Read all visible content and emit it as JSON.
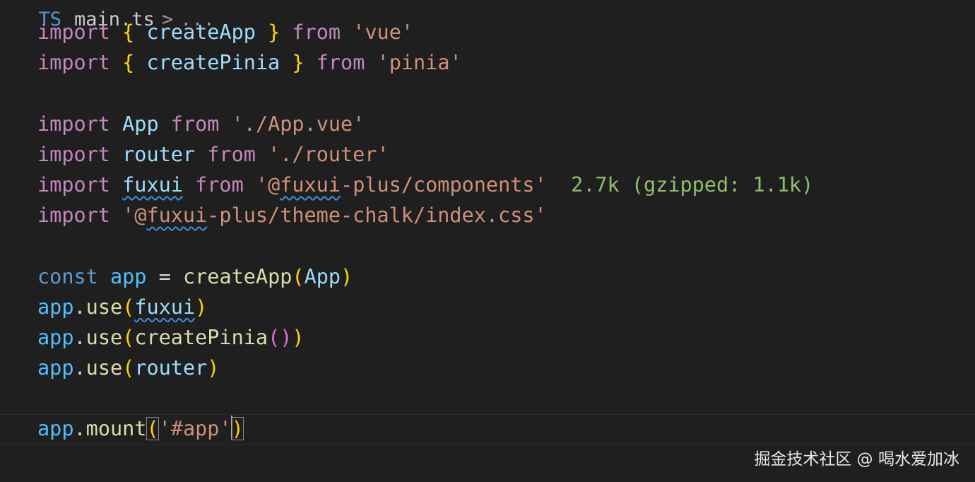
{
  "breadcrumb": {
    "lang_badge": "TS",
    "file": "main.ts",
    "separator": ">",
    "more": "..."
  },
  "code": {
    "l1": {
      "kw1": "import",
      "b1": "{",
      "name": "createApp",
      "b2": "}",
      "kw2": "from",
      "src": "'vue'"
    },
    "l2": {
      "kw1": "import",
      "b1": "{",
      "name": "createPinia",
      "b2": "}",
      "kw2": "from",
      "src": "'pinia'"
    },
    "l4": {
      "kw1": "import",
      "name": "App",
      "kw2": "from",
      "src": "'./App.vue'"
    },
    "l5": {
      "kw1": "import",
      "name": "router",
      "kw2": "from",
      "src": "'./router'"
    },
    "l6": {
      "kw1": "import",
      "name": "fuxui",
      "kw2": "from",
      "src_pre": "'@",
      "src_squig": "fuxui",
      "src_post": "-plus/components'",
      "hint": "2.7k (gzipped: 1.1k)"
    },
    "l7": {
      "kw1": "import",
      "src_pre": "'@",
      "src_squig": "fuxui",
      "src_post": "-plus/theme-chalk/index.css'"
    },
    "l9": {
      "kw": "const",
      "name": "app",
      "op": "=",
      "fn": "createApp",
      "open": "(",
      "arg": "App",
      "close": ")"
    },
    "l10": {
      "obj": "app",
      "dot": ".",
      "fn": "use",
      "open": "(",
      "arg": "fuxui",
      "close": ")"
    },
    "l11": {
      "obj": "app",
      "dot": ".",
      "fn": "use",
      "open": "(",
      "fn2": "createPinia",
      "open2": "(",
      "close2": ")",
      "close": ")"
    },
    "l12": {
      "obj": "app",
      "dot": ".",
      "fn": "use",
      "open": "(",
      "arg": "router",
      "close": ")"
    },
    "l14": {
      "obj": "app",
      "dot": ".",
      "fn": "mount",
      "open": "(",
      "arg": "'#app'",
      "close": ")"
    }
  },
  "watermark": "掘金技术社区 @ 喝水爱加冰",
  "colors": {
    "background": "#1f1f1f",
    "keyword": "#c586c0",
    "function": "#dcdcaa",
    "variable": "#9cdcfe",
    "const": "#569cd6",
    "string": "#ce9178",
    "bracket": "#ffd700",
    "bracket_nested": "#da70d6",
    "size_hint": "#8fbf6a",
    "squiggle": "#3e8ee0"
  },
  "icons": {
    "lang": "typescript-file-icon"
  }
}
